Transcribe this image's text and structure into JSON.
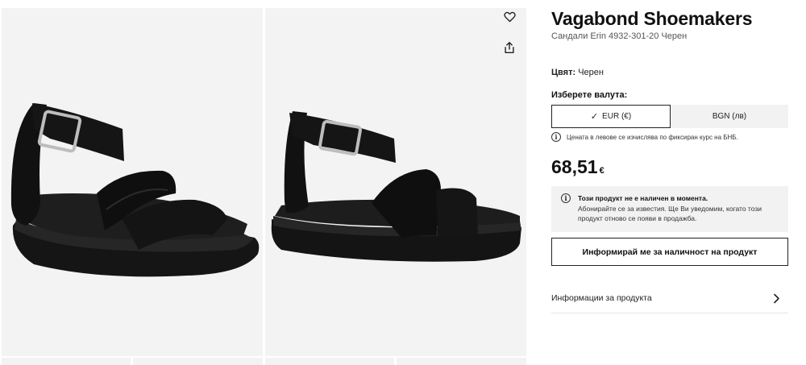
{
  "product": {
    "brand": "Vagabond Shoemakers",
    "subtitle": "Сандали Erin 4932-301-20 Черен",
    "color_label": "Цвят:",
    "color_value": "Черен"
  },
  "currency": {
    "label": "Изберете валута:",
    "options": [
      {
        "label": "EUR (€)",
        "selected": true
      },
      {
        "label": "BGN (лв)",
        "selected": false
      }
    ],
    "note": "Цената в левове се изчислява по фиксиран курс на БНБ."
  },
  "price": {
    "amount": "68,51",
    "currency_symbol": "€"
  },
  "availability": {
    "title": "Този продукт не е наличен в момента.",
    "message": "Абонирайте се за известия. Ще Ви уведомим, когато този продукт отново се появи в продажба."
  },
  "actions": {
    "notify_label": "Информирай ме за наличност на продукт",
    "details_label": "Информации за продукта"
  },
  "icons": {
    "wishlist": "heart-icon",
    "share": "share-icon",
    "details": "chevron-right-icon",
    "info": "info-icon",
    "check": "check-icon"
  },
  "colors": {
    "background_panel": "#f3f3f3",
    "text_primary": "#111111",
    "border": "#222222"
  }
}
